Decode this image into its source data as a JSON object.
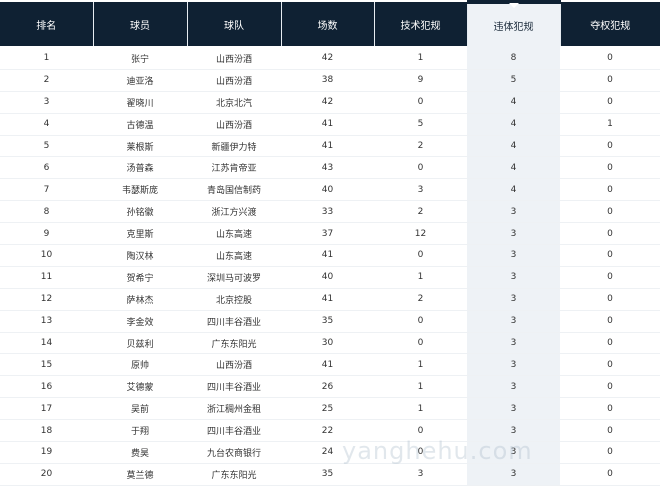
{
  "headers": {
    "rank": "排名",
    "player": "球员",
    "team": "球队",
    "games": "场数",
    "technical_fouls": "技术犯规",
    "unsportsmanlike_fouls": "违体犯规",
    "flagrant_fouls": "夺权犯规"
  },
  "sorted_column": "unsportsmanlike_fouls",
  "rows": [
    {
      "rank": "1",
      "player": "张宁",
      "team": "山西汾酒",
      "games": "42",
      "tech": "1",
      "unsport": "8",
      "flagrant": "0"
    },
    {
      "rank": "2",
      "player": "迪亚洛",
      "team": "山西汾酒",
      "games": "38",
      "tech": "9",
      "unsport": "5",
      "flagrant": "0"
    },
    {
      "rank": "3",
      "player": "翟晓川",
      "team": "北京北汽",
      "games": "42",
      "tech": "0",
      "unsport": "4",
      "flagrant": "0"
    },
    {
      "rank": "4",
      "player": "古德温",
      "team": "山西汾酒",
      "games": "41",
      "tech": "5",
      "unsport": "4",
      "flagrant": "1"
    },
    {
      "rank": "5",
      "player": "莱根斯",
      "team": "新疆伊力特",
      "games": "41",
      "tech": "2",
      "unsport": "4",
      "flagrant": "0"
    },
    {
      "rank": "6",
      "player": "汤普森",
      "team": "江苏肯帝亚",
      "games": "43",
      "tech": "0",
      "unsport": "4",
      "flagrant": "0"
    },
    {
      "rank": "7",
      "player": "韦瑟斯庞",
      "team": "青岛国信制药",
      "games": "40",
      "tech": "3",
      "unsport": "4",
      "flagrant": "0"
    },
    {
      "rank": "8",
      "player": "孙铭徽",
      "team": "浙江方兴渡",
      "games": "33",
      "tech": "2",
      "unsport": "3",
      "flagrant": "0"
    },
    {
      "rank": "9",
      "player": "克里斯",
      "team": "山东高速",
      "games": "37",
      "tech": "12",
      "unsport": "3",
      "flagrant": "0"
    },
    {
      "rank": "10",
      "player": "陶汉林",
      "team": "山东高速",
      "games": "41",
      "tech": "0",
      "unsport": "3",
      "flagrant": "0"
    },
    {
      "rank": "11",
      "player": "贺希宁",
      "team": "深圳马可波罗",
      "games": "40",
      "tech": "1",
      "unsport": "3",
      "flagrant": "0"
    },
    {
      "rank": "12",
      "player": "萨林杰",
      "team": "北京控股",
      "games": "41",
      "tech": "2",
      "unsport": "3",
      "flagrant": "0"
    },
    {
      "rank": "13",
      "player": "李金效",
      "team": "四川丰谷酒业",
      "games": "35",
      "tech": "0",
      "unsport": "3",
      "flagrant": "0"
    },
    {
      "rank": "14",
      "player": "贝兹利",
      "team": "广东东阳光",
      "games": "30",
      "tech": "0",
      "unsport": "3",
      "flagrant": "0"
    },
    {
      "rank": "15",
      "player": "原帅",
      "team": "山西汾酒",
      "games": "41",
      "tech": "1",
      "unsport": "3",
      "flagrant": "0"
    },
    {
      "rank": "16",
      "player": "艾德蒙",
      "team": "四川丰谷酒业",
      "games": "26",
      "tech": "1",
      "unsport": "3",
      "flagrant": "0"
    },
    {
      "rank": "17",
      "player": "吴前",
      "team": "浙江稠州金租",
      "games": "25",
      "tech": "1",
      "unsport": "3",
      "flagrant": "0"
    },
    {
      "rank": "18",
      "player": "于翔",
      "team": "四川丰谷酒业",
      "games": "22",
      "tech": "0",
      "unsport": "3",
      "flagrant": "0"
    },
    {
      "rank": "19",
      "player": "费昊",
      "team": "九台农商银行",
      "games": "24",
      "tech": "0",
      "unsport": "3",
      "flagrant": "0"
    },
    {
      "rank": "20",
      "player": "莫兰德",
      "team": "广东东阳光",
      "games": "35",
      "tech": "3",
      "unsport": "3",
      "flagrant": "0"
    }
  ],
  "watermark": "yanghehu.com"
}
